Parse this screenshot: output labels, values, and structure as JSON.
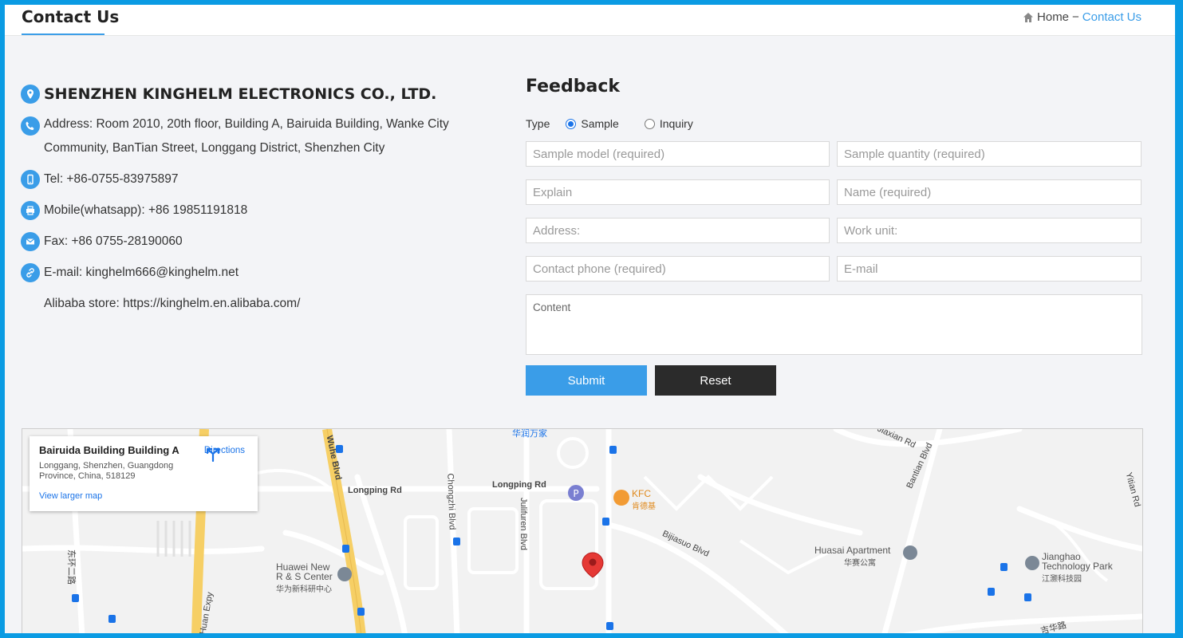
{
  "header": {
    "title": "Contact Us",
    "breadcrumb_home": "Home",
    "breadcrumb_sep": "−",
    "breadcrumb_current": "Contact Us"
  },
  "contact": {
    "company": "SHENZHEN KINGHELM ELECTRONICS CO., LTD.",
    "address": "Address: Room 2010, 20th floor, Building A, Bairuida Building, Wanke City Community, BanTian Street, Longgang District, Shenzhen City",
    "tel": "Tel: +86-0755-83975897",
    "mobile": "Mobile(whatsapp): +86 19851191818",
    "fax": "Fax: +86 0755-28190060",
    "email": "E-mail: kinghelm666@kinghelm.net",
    "alibaba": "Alibaba store: https://kinghelm.en.alibaba.com/"
  },
  "feedback": {
    "title": "Feedback",
    "type_label": "Type",
    "type_options": [
      "Sample",
      "Inquiry"
    ],
    "selected_type": "Sample",
    "fields": {
      "sample_model": "Sample model (required)",
      "sample_quantity": "Sample quantity (required)",
      "explain": "Explain",
      "name": "Name (required)",
      "address": "Address:",
      "work_unit": "Work unit:",
      "contact_phone": "Contact phone (required)",
      "email": "E-mail",
      "content": "Content"
    },
    "submit_label": "Submit",
    "reset_label": "Reset"
  },
  "map": {
    "place_title": "Bairuida Building Building A",
    "place_address": "Longgang, Shenzhen, Guangdong Province, China, 518129",
    "directions_label": "Directions",
    "larger_map_label": "View larger map",
    "labels": {
      "wuhe": "Wuhe Blvd",
      "longping_left": "Longping Rd",
      "longping_right": "Longping Rd",
      "chongzhi": "Chongzhi Blvd",
      "julifuren": "Julifuren Blvd",
      "kfc": "KFC",
      "kfc_cn": "肯德基",
      "bijiasuo": "Bijiasuo Blvd",
      "huawei": "Huawei New R & S Center",
      "huawei_cn": "华为新科研中心",
      "huasai": "Huasai Apartment",
      "huasai_cn": "华赛公寓",
      "jianghao": "Jianghao Technology Park",
      "jianghao_cn": "江灏科技园",
      "bantian": "Bantian Blvd",
      "yitian": "Yitian Rd",
      "jiaxian": "Jiaxian Rd",
      "huan": "Huan Expy",
      "dong": "东环二路",
      "top_cn": "华润万家",
      "bottom_cn": "吉华路"
    },
    "colors": {
      "highway": "#f6cf65",
      "pin": "#e53935",
      "road": "#ffffff"
    }
  }
}
